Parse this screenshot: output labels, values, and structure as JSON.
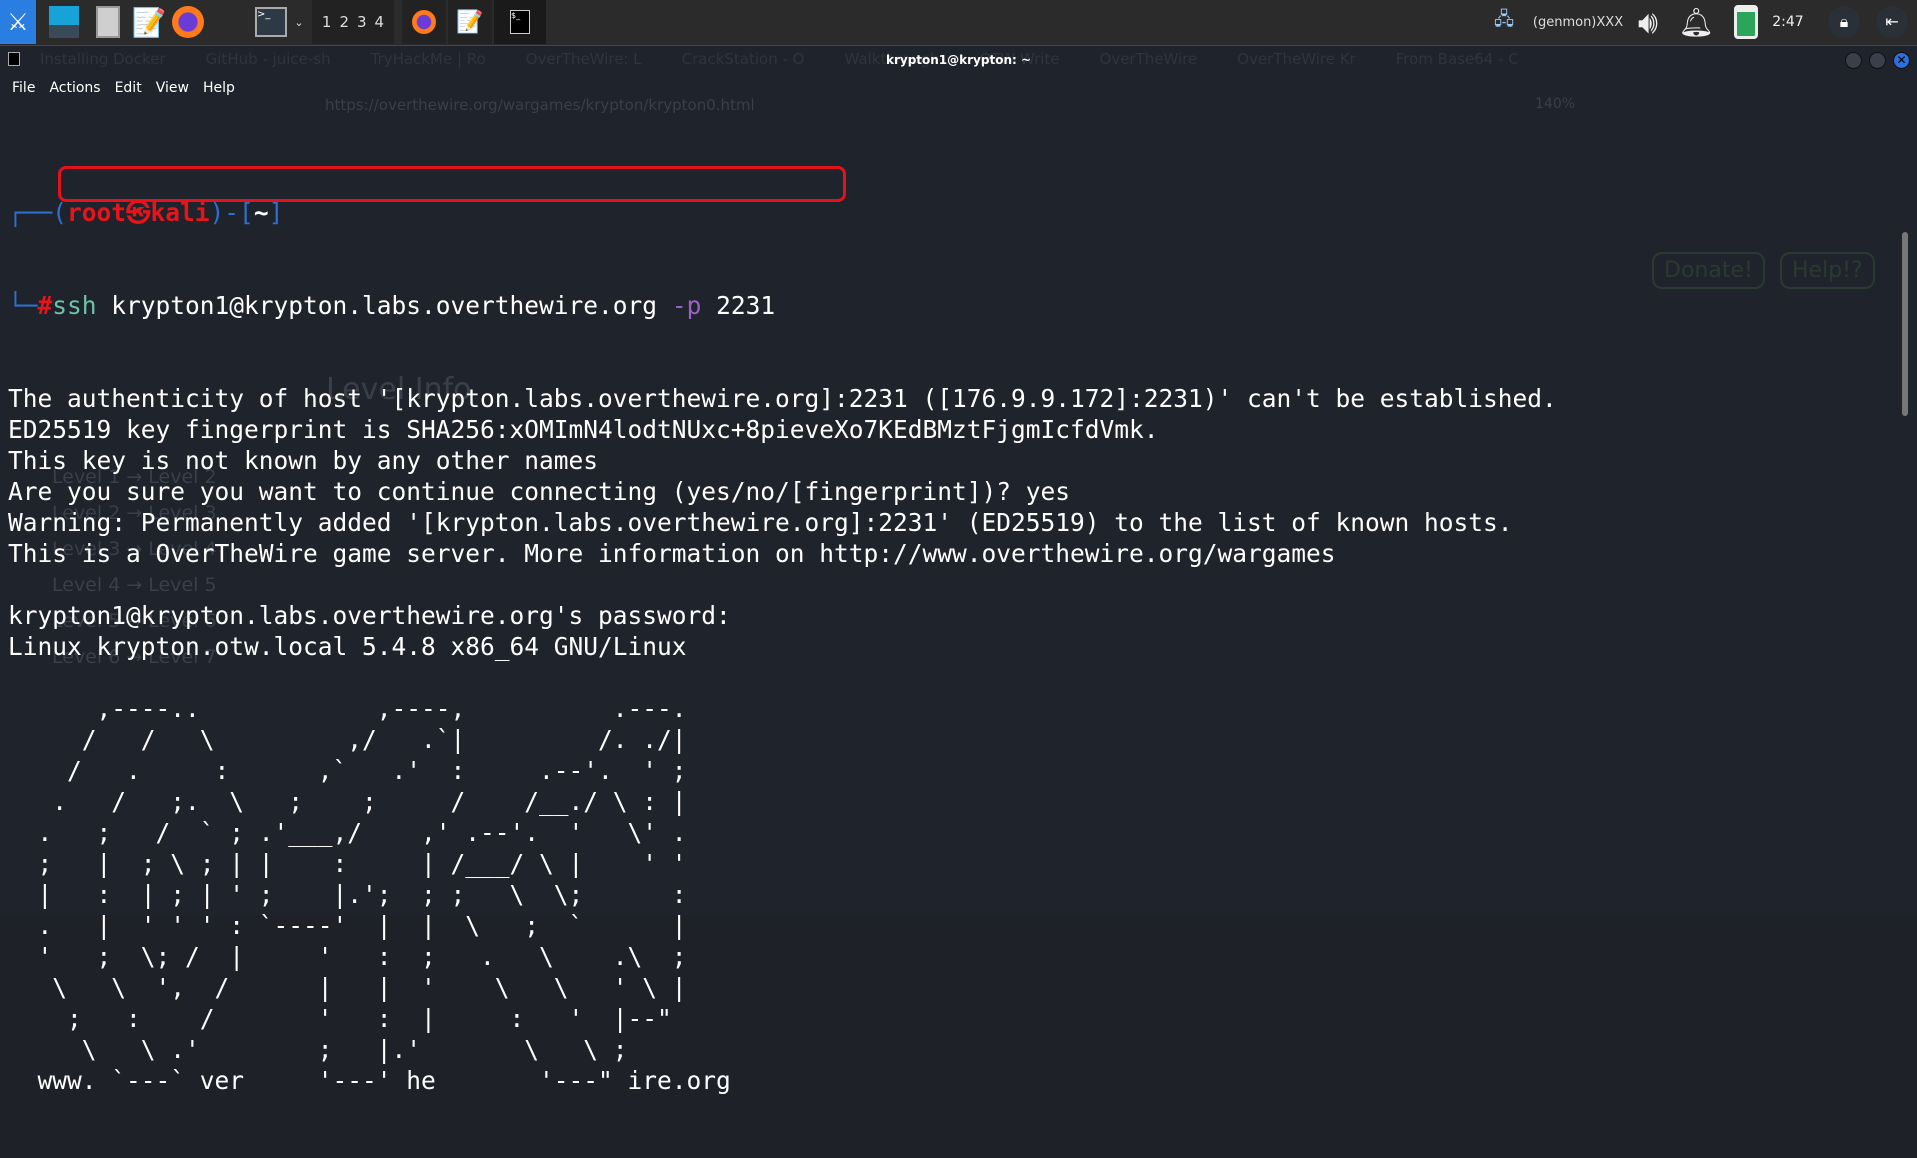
{
  "taskbar": {
    "workspaces": [
      "1",
      "2",
      "3",
      "4"
    ],
    "genmon": "(genmon)XXX",
    "clock": "2:47",
    "icons": [
      "kali-menu-icon",
      "desktop-icon",
      "file-manager-icon",
      "text-editor-icon",
      "firefox-icon",
      "terminal-icon",
      "network-icon",
      "volume-icon",
      "notification-bell-icon",
      "battery-icon",
      "lock-icon",
      "logout-icon"
    ]
  },
  "window": {
    "title": "krypton1@krypton: ~",
    "menu": [
      "File",
      "Actions",
      "Edit",
      "View",
      "Help"
    ]
  },
  "background_browser": {
    "tabs": [
      "Installing Docker",
      "GitHub - juice-sh",
      "TryHackMe | Ro",
      "OverTheWire: L",
      "CrackStation - O",
      "Walkthrough",
      "OTW Write",
      "OverTheWire",
      "OverTheWire Kr",
      "From Base64 - C"
    ],
    "url": "https://overthewire.org/wargames/krypton/krypton0.html",
    "zoom": "140%",
    "buttons": [
      "Donate!",
      "Help!?"
    ],
    "heading": "Level Info",
    "nav": [
      "Level 1 → Level 2",
      "Level 2 → Level 3",
      "Level 3 → Level 4",
      "Level 4 → Level 5",
      "Level 5 → Level 6",
      "Level 6 → Level 7"
    ]
  },
  "terminal": {
    "prompt": {
      "user": "root",
      "symbol": "㉿",
      "host": "kali",
      "dir": "~",
      "hash": "#"
    },
    "command": {
      "cmd": "ssh",
      "args": " krypton1@krypton.labs.overthewire.org ",
      "flag": "-p",
      "port": " 2231"
    },
    "output": [
      "The authenticity of host '[krypton.labs.overthewire.org]:2231 ([176.9.9.172]:2231)' can't be established.",
      "ED25519 key fingerprint is SHA256:xOMImN4lodtNUxc+8pieveXo7KEdBMztFjgmIcfdVmk.",
      "This key is not known by any other names",
      "Are you sure you want to continue connecting (yes/no/[fingerprint])? yes",
      "Warning: Permanently added '[krypton.labs.overthewire.org]:2231' (ED25519) to the list of known hosts.",
      "This is a OverTheWire game server. More information on http://www.overthewire.org/wargames",
      "",
      "krypton1@krypton.labs.overthewire.org's password:",
      "Linux krypton.otw.local 5.4.8 x86_64 GNU/Linux",
      "",
      "      ,----..            ,----,          .---.",
      "     /   /   \\         ,/   .`|         /. ./|",
      "    /   .     :      ,`   .'  :     .--'.  ' ;",
      "   .   /   ;.  \\   ;    ;     /    /__./ \\ : |",
      "  .   ;   /  ` ; .'___,/    ,' .--'.  '   \\' .",
      "  ;   |  ; \\ ; | |    :     | /___/ \\ |    ' '",
      "  |   :  | ; | ' ;    |.';  ; ;   \\  \\;      :",
      "  .   |  ' ' ' : `----'  |  |  \\   ;  `      |",
      "  '   ;  \\; /  |     '   :  ;   .   \\    .\\  ;",
      "   \\   \\  ',  /      |   |  '    \\   \\   ' \\ |",
      "    ;   :    /       '   :  |     :   '  |--\"",
      "     \\   \\ .'        ;   |.'       \\   \\ ;",
      "  www. `---` ver     '---' he       '---\" ire.org"
    ]
  }
}
